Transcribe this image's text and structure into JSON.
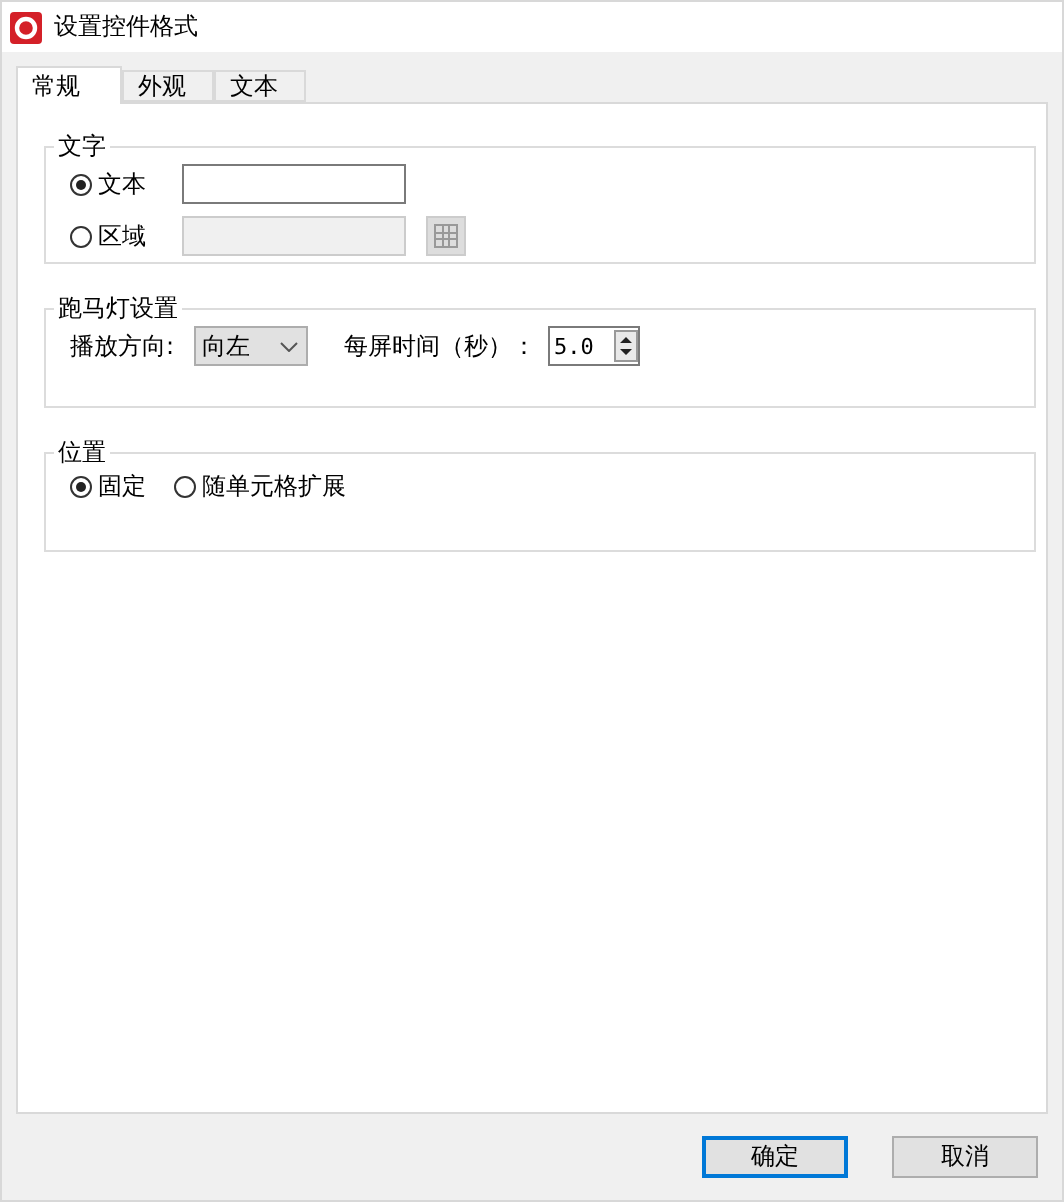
{
  "window": {
    "title": "设置控件格式"
  },
  "tabs": [
    {
      "label": "常规",
      "selected": true
    },
    {
      "label": "外观",
      "selected": false
    },
    {
      "label": "文本",
      "selected": false
    }
  ],
  "text_group": {
    "title": "文字",
    "options": [
      {
        "label": "文本",
        "selected": true,
        "kind": "text"
      },
      {
        "label": "区域",
        "selected": false,
        "kind": "range"
      }
    ]
  },
  "marquee_group": {
    "title": "跑马灯设置",
    "direction_label": "播放方向:",
    "direction_value": "向左",
    "time_label": "每屏时间（秒）：",
    "time_value": "5.0"
  },
  "position_group": {
    "title": "位置",
    "options": [
      {
        "label": "固定",
        "selected": true
      },
      {
        "label": "随单元格扩展",
        "selected": false
      }
    ]
  },
  "buttons": [
    {
      "label": "确定",
      "default": true
    },
    {
      "label": "取消",
      "default": false
    }
  ]
}
